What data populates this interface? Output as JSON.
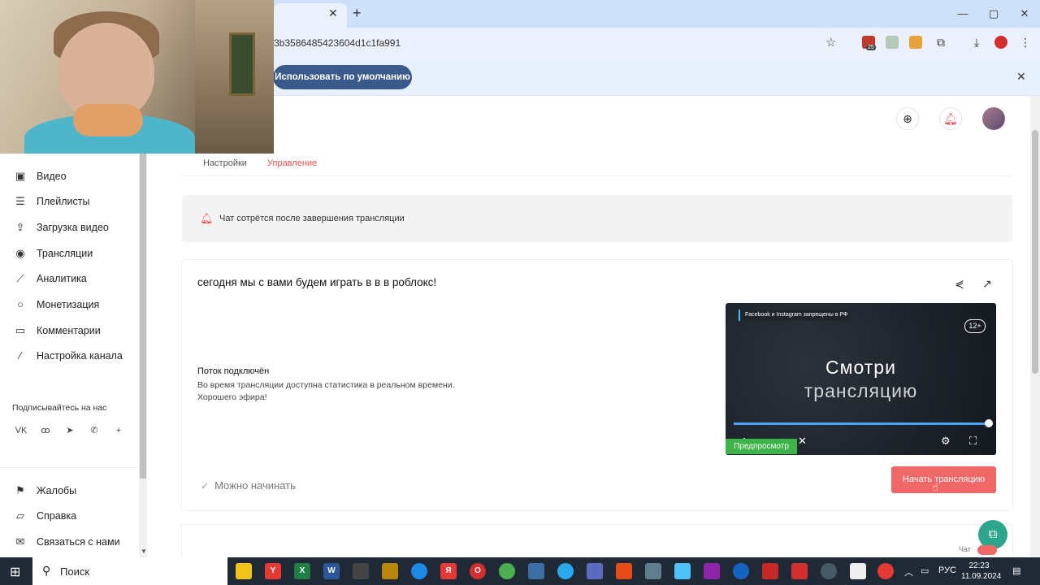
{
  "browser": {
    "url": "3b3586485423604d1c1fa991",
    "infobar_button": "Использовать по умолчанию",
    "ext_badge": "25"
  },
  "sidebar": {
    "items": [
      {
        "label": "Видео",
        "icon": "video-icon"
      },
      {
        "label": "Плейлисты",
        "icon": "playlist-icon"
      },
      {
        "label": "Загрузка видео",
        "icon": "upload-icon"
      },
      {
        "label": "Трансляции",
        "icon": "broadcast-icon"
      },
      {
        "label": "Аналитика",
        "icon": "analytics-icon"
      },
      {
        "label": "Монетизация",
        "icon": "coin-icon"
      },
      {
        "label": "Комментарии",
        "icon": "comment-icon"
      },
      {
        "label": "Настройка канала",
        "icon": "wand-icon"
      }
    ],
    "subscribe_label": "Подписывайтесь на нас",
    "social": [
      "vk-icon",
      "ok-icon",
      "telegram-icon",
      "viber-icon",
      "plus-icon"
    ],
    "footer_items": [
      {
        "label": "Жалобы",
        "icon": "flag-icon"
      },
      {
        "label": "Справка",
        "icon": "help-icon"
      },
      {
        "label": "Связаться с нами",
        "icon": "mail-icon"
      }
    ]
  },
  "tabs": [
    {
      "label": "Настройки",
      "active": false
    },
    {
      "label": "Управление",
      "active": true
    }
  ],
  "notice": {
    "text": "Чат сотрётся после завершения трансляции"
  },
  "stream": {
    "title": "сегодня мы с вами будем играть в в в роблокс!",
    "status_title": "Поток подключён",
    "status_line1": "Во время трансляции доступна статистика в реальном времени.",
    "status_line2": "Хорошего эфира!",
    "ready_text": "Можно начинать",
    "start_button": "Начать трансляцию"
  },
  "player": {
    "ban_text": "Facebook и Instagram запрещены в РФ",
    "age_rating": "12+",
    "watch_line1": "Смотри",
    "watch_line2": "трансляцию",
    "preview_badge": "Предпросмотр",
    "progress": 1.0
  },
  "chat": {
    "label": "Чат",
    "enabled": true
  },
  "taskbar": {
    "search_label": "Поиск",
    "language": "РУС",
    "time": "22:23",
    "date": "11.09.2024",
    "apps": [
      "Y",
      "X",
      "W",
      "Я",
      "O"
    ]
  },
  "colors": {
    "accent": "#f06767",
    "active_tab": "#e8504e",
    "infobar_button": "#3b5a8c",
    "chat_fab": "#2ea58d",
    "preview_badge": "#3db34a"
  }
}
